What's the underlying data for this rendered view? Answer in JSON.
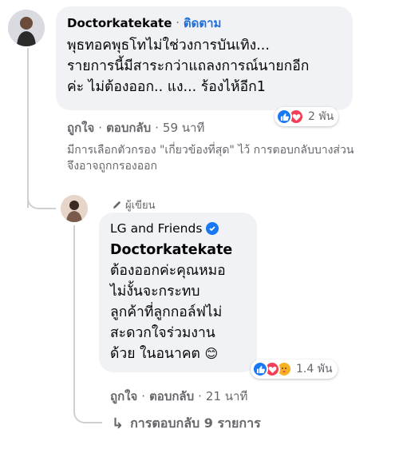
{
  "comment": {
    "author": "Doctorkatekate",
    "separator": "·",
    "follow_label": "ติดตาม",
    "lines": [
      "พุธทอคพุธโทไม่ใช่วงการบันเทิง...",
      "รายการนี้มีสาระกว่าแถลงการณ์นายกอีก",
      "ค่ะ ไม่ต้องออก.. แง... ร้องไห้อีก1"
    ],
    "reaction_count": "2 พัน",
    "reactions": [
      "like-icon",
      "love-icon"
    ],
    "like_label": "ถูกใจ",
    "reply_label": "ตอบกลับ",
    "time": "59 นาที",
    "filter_note_lines": [
      "มีการเลือกตัวกรอง \"เกี่ยวข้องที่สุด\" ไว้ การตอบกลับบางส่วน",
      "จึงอาจถูกกรองออก"
    ]
  },
  "reply": {
    "author_badge": "ผู้เขียน",
    "author": "LG and Friends",
    "verified": true,
    "lines": [
      "Doctorkatekate",
      "ต้องออกค่ะคุณหมอ",
      "ไม่งั้นจะกระทบ",
      "ลูกค้าที่ลูกกอล์ฟไม่",
      "สะดวกใจร่วมงาน",
      "ด้วย ในอนาคต"
    ],
    "emoji": "😊",
    "reaction_count": "1.4 พัน",
    "reactions": [
      "like-icon",
      "love-icon",
      "care-icon"
    ],
    "like_label": "ถูกใจ",
    "reply_label": "ตอบกลับ",
    "time": "21 นาที"
  },
  "more_replies": {
    "arrow": "↳",
    "label": "การตอบกลับ 9 รายการ"
  },
  "colors": {
    "bubble": "#f0f2f5",
    "link": "#216fdb",
    "secondary_text": "#65676b",
    "like_blue": "#1877f2",
    "love_red": "#f33e58",
    "care_yellow": "#f7b125"
  }
}
